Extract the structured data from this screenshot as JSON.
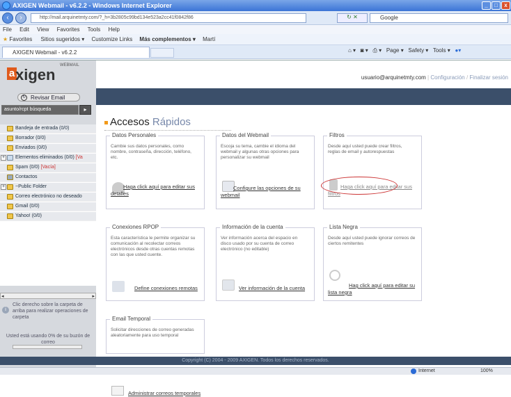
{
  "window": {
    "title": "AXIGEN Webmail - v6.2.2 - Windows Internet Explorer"
  },
  "addressbar": {
    "url": "http://mail.arquinetmty.com/?_h=3b2805c99bd134e523a2cc41f0842f86",
    "search_placeholder": "Google"
  },
  "menu": [
    "File",
    "Edit",
    "View",
    "Favorites",
    "Tools",
    "Help"
  ],
  "favorites": {
    "label": "Favorites",
    "items": [
      "Sitios sugeridos ▾",
      "Customize Links",
      "Más complementos ▾",
      "Martí"
    ]
  },
  "tab": {
    "title": "AXIGEN Webmail - v6.2.2"
  },
  "commandbar": {
    "page": "Page ▾",
    "safety": "Safety ▾",
    "tools": "Tools ▾"
  },
  "sidebar": {
    "logo_text": "xigen",
    "logo_sub": "WEBMAIL",
    "review_button": "Revisar Email",
    "search_value": "asunto/rcpt búsqueda",
    "search_go": "▸",
    "folders": [
      {
        "label": "Bandeja de entrada (0/0)",
        "extra": ""
      },
      {
        "label": "Borrador (0/0)",
        "extra": ""
      },
      {
        "label": "Enviados (0/0)",
        "extra": ""
      },
      {
        "label": "Elementos eliminados (0/0)",
        "extra": "[Va"
      },
      {
        "label": "Spam (0/0)",
        "extra": "[Vacía]"
      },
      {
        "label": "Contactos",
        "extra": ""
      },
      {
        "label": "~Public Folder",
        "extra": ""
      },
      {
        "label": "Correo electrónico no deseado",
        "extra": ""
      },
      {
        "label": "Gmail (0/0)",
        "extra": ""
      },
      {
        "label": "Yahoo! (0/0)",
        "extra": ""
      }
    ],
    "hint": "Clic derecho sobre la carpeta de arriba para realizar operaciones de carpeta",
    "quota": "Usted está usando 0% de su buzón de correo"
  },
  "header": {
    "user": "usuario@arquinetmty.com",
    "config": "Configuración",
    "logout": "Finalizar sesión"
  },
  "content": {
    "title_a": "Accesos",
    "title_b": "Rápidos",
    "cards": [
      {
        "title": "Datos Personales",
        "desc": "Cambie sus datos personales, como nombre, contraseña, dirección, teléfono, etc.",
        "action": "Haga click aquí para editar sus detalles",
        "icon": "person-icon"
      },
      {
        "title": "Datos del Webmail",
        "desc": "Escoja su tema, cambie el idioma del webmail y algunas otras opciones para personalizar su webmail",
        "action": "Configure las opciones de su webmail",
        "icon": "monitor-icon"
      },
      {
        "title": "Filtros",
        "desc": "Desde aquí usted puede crear filtros, reglas de email y autorespuestas",
        "action": "Haga click aquí para editar sus filtros",
        "icon": "filter-icon"
      },
      {
        "title": "Conexiones RPOP",
        "desc": "Esta característica le permite organizar su comunicación al recolectar correos electrónicos desde otras cuentas remotas con las que usted cuente.",
        "action": "Define conexiones remotas",
        "icon": "remote-icon"
      },
      {
        "title": "Información de la cuenta",
        "desc": "Ver información acerca del espacio en disco usado por su cuenta de correo electrónico (no editable)",
        "action": "Ver información de la cuenta",
        "icon": "info-icon"
      },
      {
        "title": "Lista Negra",
        "desc": "Desde aquí usted puede ignorar correos de ciertos remitentes",
        "action": "Hag click aquí para editar su lista negra",
        "icon": "block-icon"
      },
      {
        "title": "Email Temporal",
        "desc": "Solicitar direcciones de correo generadas aleatoriamente para uso temporal",
        "action": "Administrar correos temporales",
        "icon": "mail-icon"
      }
    ]
  },
  "footer": {
    "text": "Copyright (C) 2004 - 2009 AXIGEN. Todos los derechos reservados."
  },
  "status": {
    "zone": "Internet",
    "zoom": "100%"
  }
}
